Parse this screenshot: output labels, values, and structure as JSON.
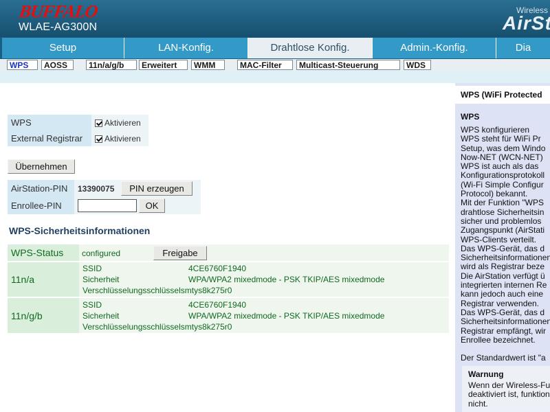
{
  "header": {
    "logo": "BUFFALO",
    "model": "WLAE-AG300N",
    "brand_wireless": "Wireless",
    "brand_product": "AirSt"
  },
  "tabs": [
    {
      "label": "Setup"
    },
    {
      "label": "LAN-Konfig."
    },
    {
      "label": "Drahtlose Konfig.",
      "active": true
    },
    {
      "label": "Admin.-Konfig."
    },
    {
      "label": "Dia"
    }
  ],
  "subtabs": [
    {
      "label": "WPS",
      "active": true
    },
    {
      "label": "AOSS"
    },
    {
      "label": "11n/a/g/b"
    },
    {
      "label": "Erweitert"
    },
    {
      "label": "WMM"
    },
    {
      "label": "MAC-Filter"
    },
    {
      "label": "Multicast-Steuerung"
    },
    {
      "label": "WDS"
    }
  ],
  "wps_settings": {
    "wps_label": "WPS",
    "wps_checkbox_label": "Aktivieren",
    "registrar_label": "External Registrar",
    "registrar_checkbox_label": "Aktivieren",
    "apply_button": "Übernehmen"
  },
  "pin": {
    "airstation_label": "AirStation-PIN",
    "airstation_value": "13390075",
    "generate_button": "PIN erzeugen",
    "enrollee_label": "Enrollee-PIN",
    "enrollee_value": "",
    "ok_button": "OK"
  },
  "security": {
    "title": "WPS-Sicherheitsinformationen",
    "status_label": "WPS-Status",
    "status_value": "configured",
    "release_button": "Freigabe",
    "bands": [
      {
        "name": "11n/a",
        "ssid_label": "SSID",
        "ssid": "4CE6760F1940",
        "security_label": "Sicherheit",
        "security": "WPA/WPA2 mixedmode - PSK TKIP/AES mixedmode",
        "key_label": "Verschlüsselungsschlüssel",
        "key": "smtys8k275r0"
      },
      {
        "name": "11n/g/b",
        "ssid_label": "SSID",
        "ssid": "4CE6760F1940",
        "security_label": "Sicherheit",
        "security": "WPA/WPA2 mixedmode - PSK TKIP/AES mixedmode",
        "key_label": "Verschlüsselungsschlüssel",
        "key": "smtys8k275r0"
      }
    ]
  },
  "help": {
    "header": "WPS (WiFi Protected",
    "title": "WPS",
    "lines": [
      "WPS konfigurieren",
      "WPS steht für WiFi Pr",
      "Setup, was dem Windo",
      "Now-NET (WCN-NET)",
      "WPS ist auch als das",
      "Konfigurationsprotokoll",
      "(Wi-Fi Simple Configur",
      "Protocol) bekannt.",
      "Mit der Funktion \"WPS",
      "drahtlose Sicherheitsin",
      "sicher und problemlos",
      "Zugangspunkt (AirStati",
      "WPS-Clients verteilt.",
      "Das WPS-Gerät, das d",
      "Sicherheitsinformationen",
      "wird als Registrar beze",
      "Die AirStation verfügt ü",
      "integrierten internen Re",
      "kann jedoch auch eine",
      "Registrar verwenden.",
      "Das WPS-Gerät, das d",
      "Sicherheitsinformationen",
      "Registrar empfängt, wir",
      "Enrollee bezeichnet.",
      "",
      "Der Standardwert ist \"a"
    ],
    "warning_title": "Warnung",
    "warning_lines": [
      "Wenn der Wireless-Fu",
      "deaktiviert ist, funktion",
      "nicht."
    ]
  }
}
